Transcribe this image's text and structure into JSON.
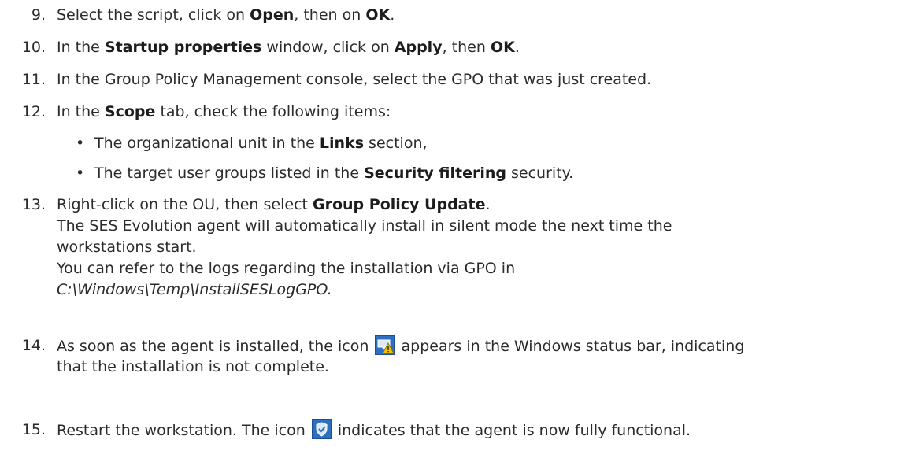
{
  "steps": [
    {
      "num": "9.",
      "parts": [
        {
          "t": "Select the script, click on "
        },
        {
          "t": "Open",
          "b": true
        },
        {
          "t": ", then on "
        },
        {
          "t": "OK",
          "b": true
        },
        {
          "t": "."
        }
      ]
    },
    {
      "num": "10.",
      "parts": [
        {
          "t": "In the "
        },
        {
          "t": "Startup properties",
          "b": true
        },
        {
          "t": " window, click on "
        },
        {
          "t": "Apply",
          "b": true
        },
        {
          "t": ", then "
        },
        {
          "t": "OK",
          "b": true
        },
        {
          "t": "."
        }
      ]
    },
    {
      "num": "11.",
      "parts": [
        {
          "t": "In the Group Policy Management console, select the GPO that was just created."
        }
      ]
    },
    {
      "num": "12.",
      "parts": [
        {
          "t": "In the "
        },
        {
          "t": "Scope",
          "b": true
        },
        {
          "t": " tab, check the following items:"
        }
      ]
    },
    {
      "num": "13.",
      "parts": [
        {
          "t": "Right-click on the OU, then select "
        },
        {
          "t": "Group Policy Update",
          "b": true
        },
        {
          "t": "."
        }
      ]
    },
    {
      "num": "14.",
      "parts": [
        {
          "t": "As soon as the agent is installed, the icon "
        },
        {
          "icon": "agent-warning-icon"
        },
        {
          "t": " appears in the Windows status bar, indicating"
        }
      ]
    },
    {
      "num": "15.",
      "parts": [
        {
          "t": "Restart the workstation. The icon "
        },
        {
          "icon": "agent-ok-icon"
        },
        {
          "t": " indicates that the agent is now fully functional."
        }
      ]
    }
  ],
  "bullets": [
    {
      "parts": [
        {
          "t": "The organizational unit in the "
        },
        {
          "t": "Links",
          "b": true
        },
        {
          "t": " section,"
        }
      ]
    },
    {
      "parts": [
        {
          "t": "The target user groups listed in the "
        },
        {
          "t": "Security filtering",
          "b": true
        },
        {
          "t": " security."
        }
      ]
    }
  ],
  "step13_lines": [
    "The SES Evolution agent will automatically install in silent mode the next time the",
    "workstations start.",
    "You can refer to the logs regarding the installation via GPO in",
    "C:\\Windows\\Temp\\InstallSESLogGPO."
  ],
  "step14_line2": "that the installation is not complete.",
  "bullet_glyph": "•",
  "colors": {
    "text": "#2b2b2b",
    "icon_blue": "#2f6fc0",
    "icon_warn": "#f2c200"
  }
}
